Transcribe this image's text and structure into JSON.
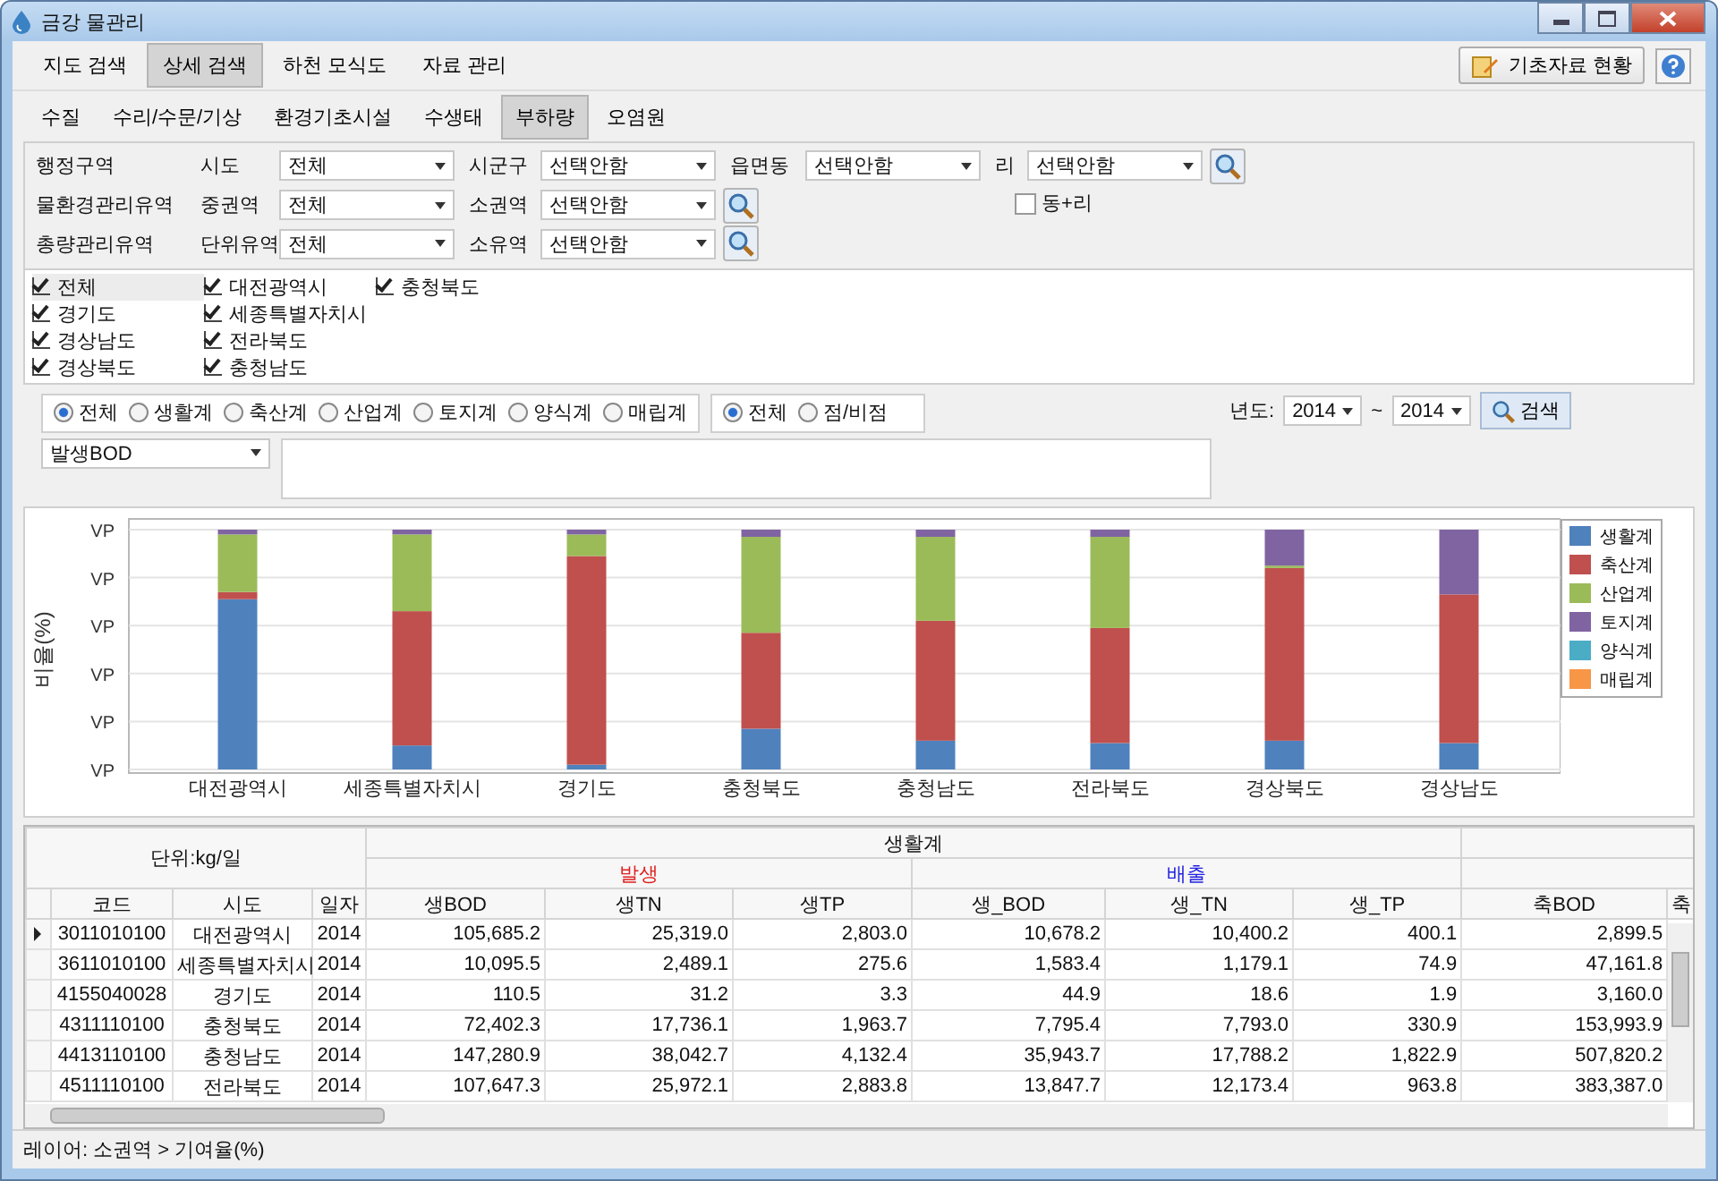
{
  "window": {
    "title": "금강 물관리"
  },
  "main_tabs": [
    {
      "label": "지도 검색",
      "selected": false
    },
    {
      "label": "상세 검색",
      "selected": true
    },
    {
      "label": "하천 모식도",
      "selected": false
    },
    {
      "label": "자료 관리",
      "selected": false
    }
  ],
  "basic_data_button": "기초자료 현황",
  "sub_tabs": [
    {
      "label": "수질",
      "selected": false
    },
    {
      "label": "수리/수문/기상",
      "selected": false
    },
    {
      "label": "환경기초시설",
      "selected": false
    },
    {
      "label": "수생태",
      "selected": false
    },
    {
      "label": "부하량",
      "selected": true
    },
    {
      "label": "오염원",
      "selected": false
    }
  ],
  "filters": [
    {
      "group": "행정구역",
      "fields": [
        {
          "label": "시도",
          "value": "전체"
        },
        {
          "label": "시군구",
          "value": "선택안함"
        },
        {
          "label": "읍면동",
          "value": "선택안함"
        },
        {
          "label": "리",
          "value": "선택안함"
        }
      ]
    },
    {
      "group": "물환경관리유역",
      "fields": [
        {
          "label": "중권역",
          "value": "전체"
        },
        {
          "label": "소권역",
          "value": "선택안함"
        }
      ]
    },
    {
      "group": "총량관리유역",
      "fields": [
        {
          "label": "단위유역",
          "value": "전체"
        },
        {
          "label": "소유역",
          "value": "선택안함"
        }
      ]
    }
  ],
  "dong_ri": {
    "label": "동+리",
    "checked": false
  },
  "regions": [
    {
      "label": "전체",
      "checked": true
    },
    {
      "label": "경기도",
      "checked": true
    },
    {
      "label": "경상남도",
      "checked": true
    },
    {
      "label": "경상북도",
      "checked": true
    },
    {
      "label": "대전광역시",
      "checked": true
    },
    {
      "label": "세종특별자치시",
      "checked": true
    },
    {
      "label": "전라북도",
      "checked": true
    },
    {
      "label": "충청남도",
      "checked": true
    },
    {
      "label": "충청북도",
      "checked": true
    }
  ],
  "source_options": [
    {
      "label": "전체",
      "selected": true
    },
    {
      "label": "생활계",
      "selected": false
    },
    {
      "label": "축산계",
      "selected": false
    },
    {
      "label": "산업계",
      "selected": false
    },
    {
      "label": "토지계",
      "selected": false
    },
    {
      "label": "양식계",
      "selected": false
    },
    {
      "label": "매립계",
      "selected": false
    }
  ],
  "point_options": [
    {
      "label": "전체",
      "selected": true
    },
    {
      "label": "점/비점",
      "selected": false
    }
  ],
  "year_label": "년도:",
  "year_from": "2014",
  "year_sep": "~",
  "year_to": "2014",
  "search_button": "검색",
  "item_select": "발생BOD",
  "chart": {
    "y_axis_title": "비율(%)",
    "y_tick_labels": [
      "VP",
      "VP",
      "VP",
      "VP",
      "VP",
      "VP"
    ],
    "categories": [
      "대전광역시",
      "세종특별자치시",
      "경기도",
      "충청북도",
      "충청남도",
      "전라북도",
      "경상북도",
      "경상남도"
    ],
    "legend": [
      {
        "name": "생활계",
        "color": "#4f81bd"
      },
      {
        "name": "축산계",
        "color": "#c0504d"
      },
      {
        "name": "산업계",
        "color": "#9bbb59"
      },
      {
        "name": "토지계",
        "color": "#8064a2"
      },
      {
        "name": "양식계",
        "color": "#4bacc6"
      },
      {
        "name": "매립계",
        "color": "#f79646"
      }
    ]
  },
  "table": {
    "unit": "단위:kg/일",
    "groups": [
      {
        "label": "생활계"
      }
    ],
    "subgroups": [
      {
        "label": "발생",
        "color": "#e02020"
      },
      {
        "label": "배출",
        "color": "#2020e0"
      }
    ],
    "columns": [
      "코드",
      "시도",
      "일자",
      "생BOD",
      "생TN",
      "생TP",
      "생_BOD",
      "생_TN",
      "생_TP",
      "축BOD",
      "축"
    ],
    "rows": [
      {
        "current": true,
        "cells": [
          "3011010100",
          "대전광역시",
          "2014",
          "105,685.2",
          "25,319.0",
          "2,803.0",
          "10,678.2",
          "10,400.2",
          "400.1",
          "2,899.5"
        ]
      },
      {
        "current": false,
        "cells": [
          "3611010100",
          "세종특별자치시",
          "2014",
          "10,095.5",
          "2,489.1",
          "275.6",
          "1,583.4",
          "1,179.1",
          "74.9",
          "47,161.8"
        ]
      },
      {
        "current": false,
        "cells": [
          "4155040028",
          "경기도",
          "2014",
          "110.5",
          "31.2",
          "3.3",
          "44.9",
          "18.6",
          "1.9",
          "3,160.0"
        ]
      },
      {
        "current": false,
        "cells": [
          "4311110100",
          "충청북도",
          "2014",
          "72,402.3",
          "17,736.1",
          "1,963.7",
          "7,795.4",
          "7,793.0",
          "330.9",
          "153,993.9"
        ]
      },
      {
        "current": false,
        "cells": [
          "4413110100",
          "충청남도",
          "2014",
          "147,280.9",
          "38,042.7",
          "4,132.4",
          "35,943.7",
          "17,788.2",
          "1,822.9",
          "507,820.2"
        ]
      },
      {
        "current": false,
        "cells": [
          "4511110100",
          "전라북도",
          "2014",
          "107,647.3",
          "25,972.1",
          "2,883.8",
          "13,847.7",
          "12,173.4",
          "963.8",
          "383,387.0"
        ]
      }
    ]
  },
  "status_bar": "레이어: 소권역 > 기여율(%)"
}
